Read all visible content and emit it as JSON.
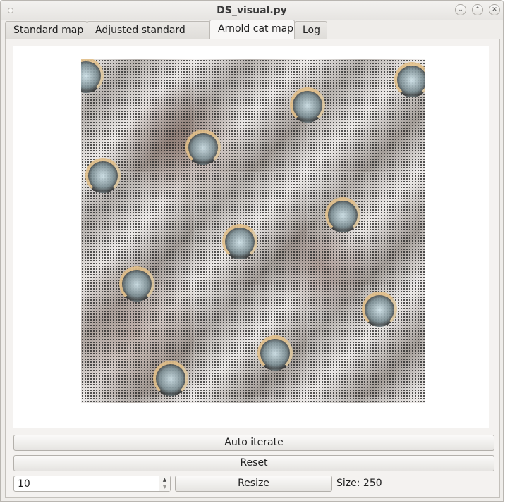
{
  "window": {
    "title": "DS_visual.py"
  },
  "tabs": [
    {
      "label": "Standard map",
      "active": false
    },
    {
      "label": "Adjusted standard map",
      "active": false
    },
    {
      "label": "Arnold cat map",
      "active": true
    },
    {
      "label": "Log",
      "active": false
    }
  ],
  "controls": {
    "auto_iterate_label": "Auto iterate",
    "reset_label": "Reset",
    "iterations_value": "10",
    "resize_label": "Resize",
    "size_label": "Size: 250"
  },
  "icons": {
    "window_dot": "window-menu-icon",
    "minimize": "chevron-down-icon",
    "maximize": "chevron-up-icon",
    "close": "close-icon",
    "spin_up": "arrow-up-icon",
    "spin_down": "arrow-down-icon"
  },
  "colors": {
    "window_bg": "#efedea",
    "canvas_bg": "#ffffff",
    "accent_ring": "#e3c08a"
  }
}
